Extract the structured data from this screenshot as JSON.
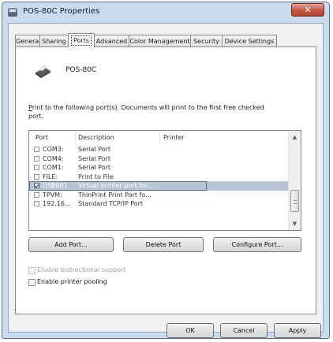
{
  "window": {
    "title": "POS-80C Properties",
    "close_glyph": "✕"
  },
  "tabs": [
    {
      "label": "General",
      "active": false
    },
    {
      "label": "Sharing",
      "active": false
    },
    {
      "label": "Ports",
      "active": true
    },
    {
      "label": "Advanced",
      "active": false
    },
    {
      "label": "Color Management",
      "active": false
    },
    {
      "label": "Security",
      "active": false
    },
    {
      "label": "Device Settings",
      "active": false
    }
  ],
  "printer": {
    "name": "POS-80C",
    "icon": "printer-icon"
  },
  "description": {
    "prefix": "P",
    "rest": "rint to the following port(s). Documents will print to the first free checked port."
  },
  "port_list": {
    "headers": {
      "port": "Port",
      "description": "Description",
      "printer": "Printer"
    },
    "rows": [
      {
        "port": "COM3:",
        "description": "Serial Port",
        "checked": false,
        "selected": false
      },
      {
        "port": "COM4:",
        "description": "Serial Port",
        "checked": false,
        "selected": false
      },
      {
        "port": "COM1:",
        "description": "Serial Port",
        "checked": false,
        "selected": false
      },
      {
        "port": "FILE:",
        "description": "Print to File",
        "checked": false,
        "selected": false
      },
      {
        "port": "USB001",
        "description": "Virtual printer port for...",
        "checked": true,
        "selected": true
      },
      {
        "port": "TPVM:",
        "description": "ThinPrint Print Port fo...",
        "checked": false,
        "selected": false
      },
      {
        "port": "192.16...",
        "description": "Standard TCP/IP Port",
        "checked": false,
        "selected": false
      }
    ],
    "scroll_up": "▲",
    "scroll_down": "▼"
  },
  "buttons": {
    "add_port": "Add Port...",
    "delete_port": "Delete Port",
    "configure_port": "Configure Port...",
    "ok": "OK",
    "cancel": "Cancel",
    "apply": "Apply"
  },
  "options": {
    "bidirectional": {
      "label": "Enable bidirectional support",
      "checked": false,
      "enabled": false
    },
    "pooling": {
      "label": "Enable printer pooling",
      "checked": false,
      "enabled": true
    }
  }
}
